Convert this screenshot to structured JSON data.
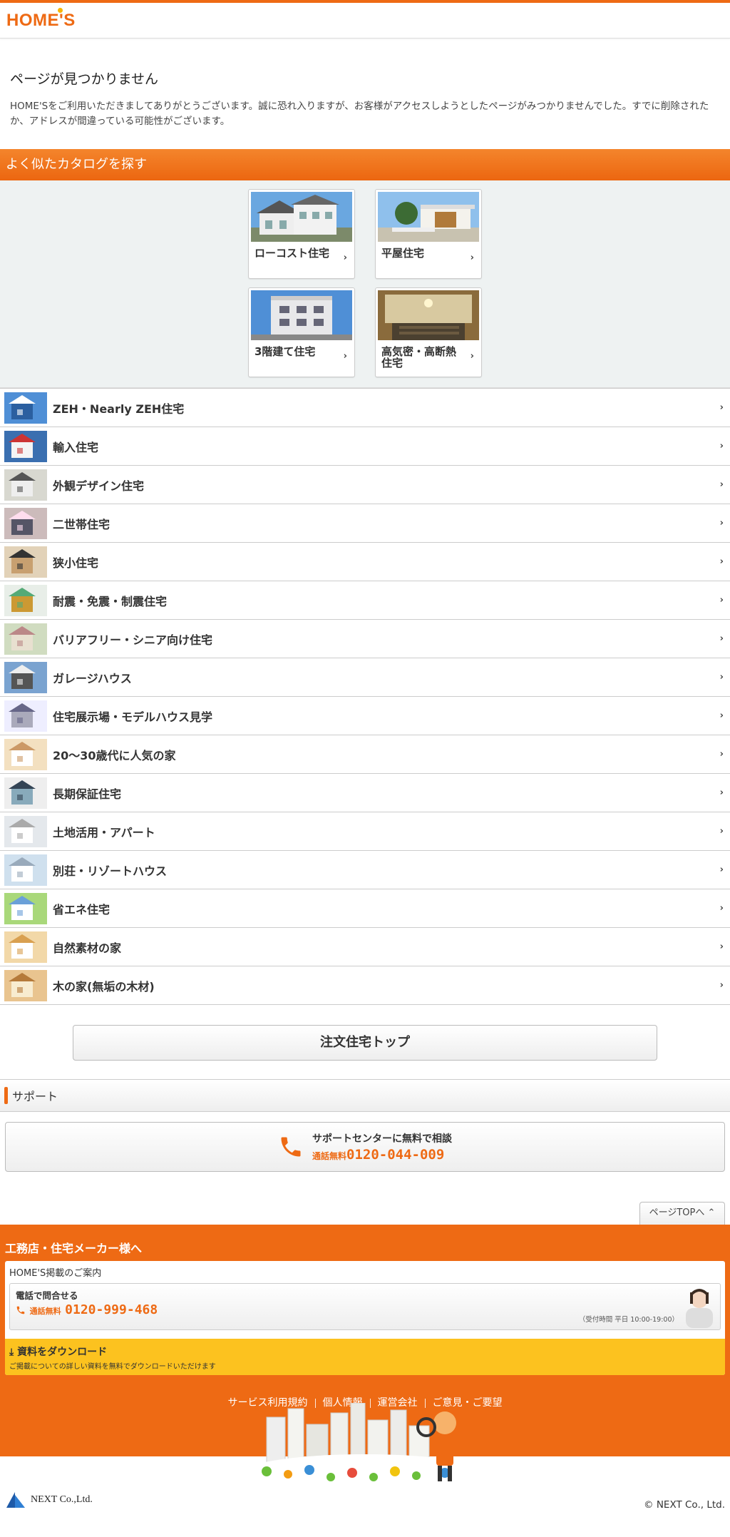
{
  "header": {
    "logo_text": "HOME'S"
  },
  "notfound": {
    "title": "ページが見つかりません",
    "message": "HOME'Sをご利用いただきましてありがとうございます。誠に恐れ入りますが、お客様がアクセスしようとしたページがみつかりませんでした。すでに削除されたか、アドレスが間違っている可能性がございます。"
  },
  "catalog": {
    "section_title": "よく似たカタログを探す",
    "cards": [
      {
        "label": "ローコスト住宅"
      },
      {
        "label": "平屋住宅"
      },
      {
        "label": "3階建て住宅"
      },
      {
        "label": "高気密・高断熱住宅"
      }
    ],
    "list": [
      {
        "label": "ZEH・Nearly ZEH住宅"
      },
      {
        "label": "輸入住宅"
      },
      {
        "label": "外観デザイン住宅"
      },
      {
        "label": "二世帯住宅"
      },
      {
        "label": "狭小住宅"
      },
      {
        "label": "耐震・免震・制震住宅"
      },
      {
        "label": "バリアフリー・シニア向け住宅"
      },
      {
        "label": "ガレージハウス"
      },
      {
        "label": "住宅展示場・モデルハウス見学"
      },
      {
        "label": "20〜30歳代に人気の家"
      },
      {
        "label": "長期保証住宅"
      },
      {
        "label": "土地活用・アパート"
      },
      {
        "label": "別荘・リゾートハウス"
      },
      {
        "label": "省エネ住宅"
      },
      {
        "label": "自然素材の家"
      },
      {
        "label": "木の家(無垢の木材)"
      }
    ],
    "top_button": "注文住宅トップ"
  },
  "support": {
    "section_title": "サポート",
    "consult_text": "サポートセンターに無料で相談",
    "free_call": "通話無料",
    "phone": "0120-044-009"
  },
  "pagetop": {
    "label": "ページTOPへ"
  },
  "footer": {
    "builders_title": "工務店・住宅メーカー様へ",
    "listing_info": "HOME'S掲載のご案内",
    "phone_inquiry": "電話で問合せる",
    "free_call": "通話無料",
    "phone": "0120-999-468",
    "hours": "（受付時間 平日 10:00-19:00）",
    "download_title": "資料をダウンロード",
    "download_desc": "ご掲載についての詳しい資料を無料でダウンロードいただけます",
    "links": [
      "サービス利用規約",
      "個人情報",
      "運営会社",
      "ご意見・ご要望"
    ],
    "company_logo": "NEXT Co.,Ltd.",
    "copyright": "© NEXT Co., Ltd."
  },
  "colors": {
    "brand_orange": "#ee6a14",
    "download_yellow": "#fcc21f"
  }
}
